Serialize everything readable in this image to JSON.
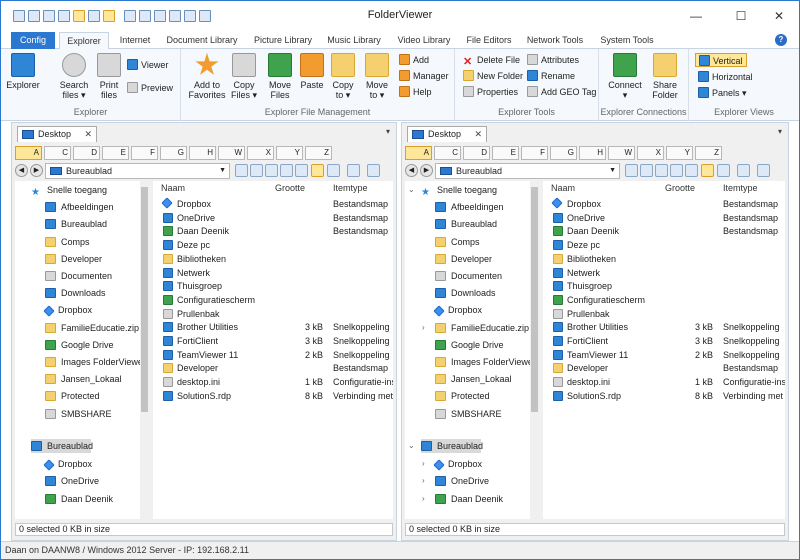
{
  "window": {
    "title": "FolderViewer",
    "min": "—",
    "max": "☐",
    "close": "✕"
  },
  "tabs": [
    {
      "label": "Config"
    },
    {
      "label": "Explorer"
    },
    {
      "label": "Internet"
    },
    {
      "label": "Document Library"
    },
    {
      "label": "Picture Library"
    },
    {
      "label": "Music Library"
    },
    {
      "label": "Video Library"
    },
    {
      "label": "File Editors"
    },
    {
      "label": "Network Tools"
    },
    {
      "label": "System Tools"
    }
  ],
  "help": "?",
  "ribbon": {
    "explorer_group": {
      "label": "Explorer",
      "explorer": "Explorer",
      "search": "Search\nfiles ▾",
      "print": "Print\nfiles",
      "viewer": "Viewer",
      "preview": "Preview"
    },
    "fm_group": {
      "label": "Explorer File Management",
      "add_fav": "Add to\nFavorites",
      "copy_files": "Copy\nFiles ▾",
      "move_files": "Move\nFiles",
      "paste": "Paste",
      "copy_to": "Copy\nto ▾",
      "move_to": "Move\nto ▾",
      "add": "Add",
      "manager": "Manager",
      "help": "Help"
    },
    "tools_group": {
      "label": "Explorer Tools",
      "delete": "Delete File",
      "new_folder": "New Folder",
      "properties": "Properties",
      "attributes": "Attributes",
      "rename": "Rename",
      "geo": "Add GEO Tag"
    },
    "conn_group": {
      "label": "Explorer Connections",
      "connect": "Connect\n▾",
      "share": "Share\nFolder"
    },
    "views_group": {
      "label": "Explorer Views",
      "vertical": "Vertical",
      "horizontal": "Horizontal",
      "panels": "Panels ▾"
    }
  },
  "panes": [
    {
      "tab": "Desktop",
      "tab_close": "✕",
      "address": "Bureaublad",
      "drives": [
        "A",
        "C",
        "D",
        "E",
        "F",
        "G",
        "H",
        "W",
        "X",
        "Y",
        "Z"
      ],
      "tree_top": [
        {
          "label": "Snelle toegang",
          "icon": "star-icon"
        },
        {
          "label": "Afbeeldingen",
          "icon": "pictures-icon"
        },
        {
          "label": "Bureaublad",
          "icon": "desktop-icon"
        },
        {
          "label": "Comps",
          "icon": "folder-icon"
        },
        {
          "label": "Developer",
          "icon": "folder-icon"
        },
        {
          "label": "Documenten",
          "icon": "documents-icon"
        },
        {
          "label": "Downloads",
          "icon": "downloads-icon"
        },
        {
          "label": "Dropbox",
          "icon": "dropbox-icon"
        },
        {
          "label": "FamilieEducatie.zip",
          "icon": "zip-icon"
        },
        {
          "label": "Google Drive",
          "icon": "drive-icon"
        },
        {
          "label": "Images FolderViewer",
          "icon": "folder-icon"
        },
        {
          "label": "Jansen_Lokaal",
          "icon": "folder-icon"
        },
        {
          "label": "Protected",
          "icon": "folder-icon"
        },
        {
          "label": "SMBSHARE",
          "icon": "network-drive-icon"
        }
      ],
      "tree_bottom": [
        {
          "label": "Bureaublad",
          "icon": "desktop-icon"
        },
        {
          "label": "Dropbox",
          "icon": "dropbox-icon"
        },
        {
          "label": "OneDrive",
          "icon": "onedrive-icon"
        },
        {
          "label": "Daan Deenik",
          "icon": "user-icon"
        }
      ],
      "status": "0 selected 0 KB in size"
    },
    {
      "tab": "Desktop",
      "tab_close": "✕",
      "address": "Bureaublad",
      "drives": [
        "A",
        "C",
        "D",
        "E",
        "F",
        "G",
        "H",
        "W",
        "X",
        "Y",
        "Z"
      ],
      "tree_top": [
        {
          "label": "Snelle toegang",
          "icon": "star-icon"
        },
        {
          "label": "Afbeeldingen",
          "icon": "pictures-icon"
        },
        {
          "label": "Bureaublad",
          "icon": "desktop-icon"
        },
        {
          "label": "Comps",
          "icon": "folder-icon"
        },
        {
          "label": "Developer",
          "icon": "folder-icon"
        },
        {
          "label": "Documenten",
          "icon": "documents-icon"
        },
        {
          "label": "Downloads",
          "icon": "downloads-icon"
        },
        {
          "label": "Dropbox",
          "icon": "dropbox-icon"
        },
        {
          "label": "FamilieEducatie.zip",
          "icon": "zip-icon"
        },
        {
          "label": "Google Drive",
          "icon": "drive-icon"
        },
        {
          "label": "Images FolderViewer",
          "icon": "folder-icon"
        },
        {
          "label": "Jansen_Lokaal",
          "icon": "folder-icon"
        },
        {
          "label": "Protected",
          "icon": "folder-icon"
        },
        {
          "label": "SMBSHARE",
          "icon": "network-drive-icon"
        }
      ],
      "tree_bottom": [
        {
          "label": "Bureaublad",
          "icon": "desktop-icon"
        },
        {
          "label": "Dropbox",
          "icon": "dropbox-icon"
        },
        {
          "label": "OneDrive",
          "icon": "onedrive-icon"
        },
        {
          "label": "Daan Deenik",
          "icon": "user-icon"
        }
      ],
      "status": "0 selected 0 KB in size"
    }
  ],
  "columns": {
    "name": "Naam",
    "size": "Grootte",
    "type": "Itemtype"
  },
  "files": [
    {
      "name": "Dropbox",
      "size": "",
      "type": "Bestandsmap",
      "icon": "dropbox-icon"
    },
    {
      "name": "OneDrive",
      "size": "",
      "type": "Bestandsmap",
      "icon": "onedrive-icon"
    },
    {
      "name": "Daan Deenik",
      "size": "",
      "type": "Bestandsmap",
      "icon": "user-icon"
    },
    {
      "name": "Deze pc",
      "size": "",
      "type": "",
      "icon": "computer-icon"
    },
    {
      "name": "Bibliotheken",
      "size": "",
      "type": "",
      "icon": "libraries-icon"
    },
    {
      "name": "Netwerk",
      "size": "",
      "type": "",
      "icon": "network-icon"
    },
    {
      "name": "Thuisgroep",
      "size": "",
      "type": "",
      "icon": "homegroup-icon"
    },
    {
      "name": "Configuratiescherm",
      "size": "",
      "type": "",
      "icon": "control-panel-icon"
    },
    {
      "name": "Prullenbak",
      "size": "",
      "type": "",
      "icon": "recycle-bin-icon"
    },
    {
      "name": "Brother Utilities",
      "size": "3 kB",
      "type": "Snelkoppeling",
      "icon": "shortcut-icon"
    },
    {
      "name": "FortiClient",
      "size": "3 kB",
      "type": "Snelkoppeling",
      "icon": "shortcut-icon"
    },
    {
      "name": "TeamViewer 11",
      "size": "2 kB",
      "type": "Snelkoppeling",
      "icon": "shortcut-icon"
    },
    {
      "name": "Developer",
      "size": "",
      "type": "Bestandsmap",
      "icon": "folder-icon"
    },
    {
      "name": "desktop.ini",
      "size": "1 kB",
      "type": "Configuratie-inste...",
      "icon": "ini-file-icon"
    },
    {
      "name": "SolutionS.rdp",
      "size": "8 kB",
      "type": "Verbinding met ex...",
      "icon": "rdp-file-icon"
    }
  ],
  "status": "Daan on DAANW8 / Windows 2012 Server  -  IP: 192.168.2.11"
}
